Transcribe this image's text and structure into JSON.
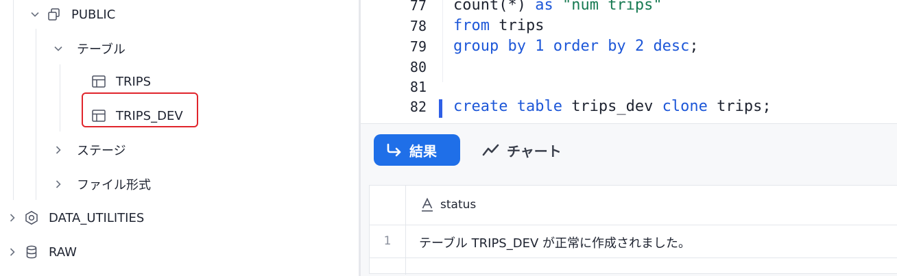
{
  "tree": {
    "schema_public": "PUBLIC",
    "folder_tables": "テーブル",
    "table_trips": "TRIPS",
    "table_trips_dev": "TRIPS_DEV",
    "folder_stages": "ステージ",
    "folder_file_formats": "ファイル形式",
    "db_data_utilities": "DATA_UTILITIES",
    "db_raw": "RAW"
  },
  "editor": {
    "lines": [
      {
        "num": "77",
        "parts": [
          {
            "t": "count(*) ",
            "c": "plain"
          },
          {
            "t": "as ",
            "c": "kw"
          },
          {
            "t": "\"num trips\"",
            "c": "str"
          }
        ]
      },
      {
        "num": "78",
        "parts": [
          {
            "t": "from ",
            "c": "kw"
          },
          {
            "t": "trips",
            "c": "plain"
          }
        ]
      },
      {
        "num": "79",
        "parts": [
          {
            "t": "group by ",
            "c": "kw"
          },
          {
            "t": "1 ",
            "c": "kw"
          },
          {
            "t": "order by ",
            "c": "kw"
          },
          {
            "t": "2 ",
            "c": "kw"
          },
          {
            "t": "desc",
            "c": "kw"
          },
          {
            "t": ";",
            "c": "plain"
          }
        ]
      },
      {
        "num": "80",
        "parts": []
      },
      {
        "num": "81",
        "parts": []
      },
      {
        "num": "82",
        "parts": [
          {
            "t": "create table ",
            "c": "kw"
          },
          {
            "t": "trips_dev ",
            "c": "plain"
          },
          {
            "t": "clone ",
            "c": "kw"
          },
          {
            "t": "trips;",
            "c": "plain"
          }
        ]
      }
    ]
  },
  "results": {
    "tab_results_label": "結果",
    "tab_chart_label": "チャート",
    "column_header": "status",
    "row_number": "1",
    "row_value": "テーブル TRIPS_DEV が正常に作成されました。"
  },
  "colors": {
    "accent": "#1f6fe8",
    "keyword": "#1d57d8",
    "string": "#177a52",
    "highlight_border": "#e0242b"
  }
}
